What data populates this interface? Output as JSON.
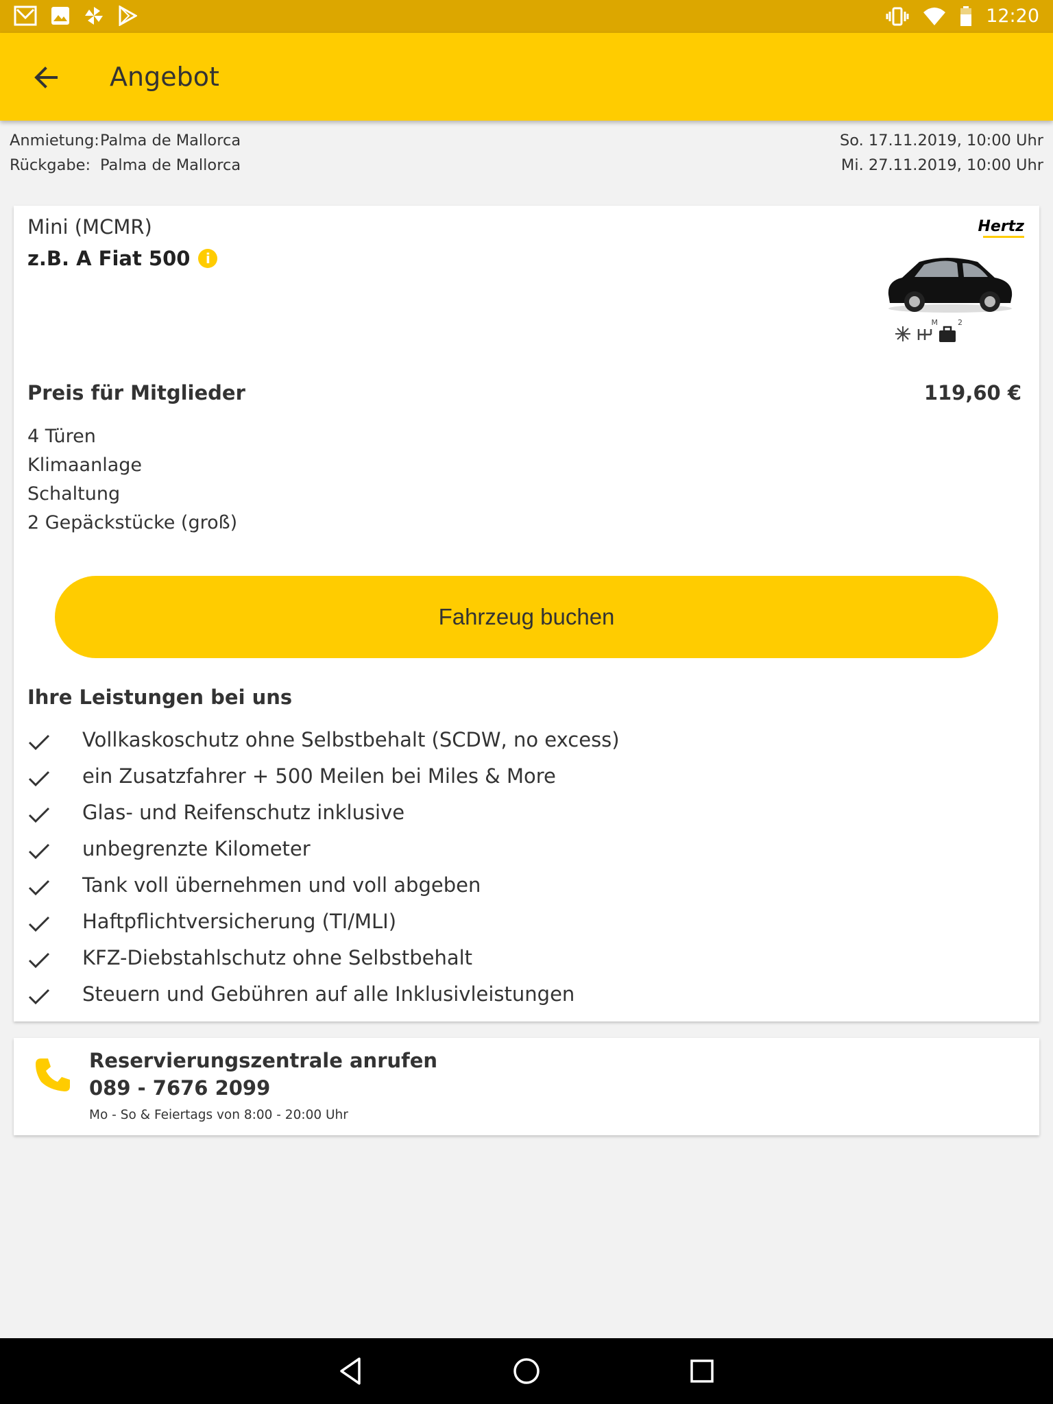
{
  "status_bar": {
    "time": "12:20",
    "icons_left": [
      "gmail-icon",
      "gallery-icon",
      "pinwheel-icon",
      "play-store-icon"
    ],
    "icons_right": [
      "vibrate-icon",
      "wifi-icon",
      "battery-icon"
    ]
  },
  "app_bar": {
    "title": "Angebot"
  },
  "rental": {
    "pickup_label": "Anmietung:",
    "pickup_place": "Palma de Mallorca",
    "pickup_date": "So. 17.11.2019, 10:00 Uhr",
    "return_label": "Rückgabe:",
    "return_place": "Palma de Mallorca",
    "return_date": "Mi. 27.11.2019, 10:00 Uhr"
  },
  "offer": {
    "category": "Mini (MCMR)",
    "model": "z.B. A Fiat 500",
    "brand": "Hertz",
    "feature_badges": {
      "transmission": "M",
      "bags": "2"
    },
    "price_label": "Preis für Mitglieder",
    "price": "119,60 €",
    "specs": [
      "4 Türen",
      "Klimaanlage",
      "Schaltung",
      "2 Gepäckstücke (groß)"
    ],
    "book_label": "Fahrzeug buchen",
    "services_title": "Ihre Leistungen bei uns",
    "services": [
      "Vollkaskoschutz ohne Selbstbehalt (SCDW, no excess)",
      "ein Zusatzfahrer + 500 Meilen bei Miles & More",
      "Glas- und Reifenschutz inklusive",
      "unbegrenzte Kilometer",
      "Tank voll übernehmen und voll abgeben",
      "Haftpflichtversicherung (TI/MLI)",
      "KFZ-Diebstahlschutz ohne Selbstbehalt",
      "Steuern und Gebühren auf alle Inklusivleistungen"
    ]
  },
  "call": {
    "title": "Reservierungszentrale anrufen",
    "number": "089 - 7676 2099",
    "hours": "Mo - So & Feiertags von 8:00 - 20:00 Uhr"
  },
  "colors": {
    "accent": "#ffcc00",
    "status_bar": "#dca700",
    "text": "#333333"
  }
}
